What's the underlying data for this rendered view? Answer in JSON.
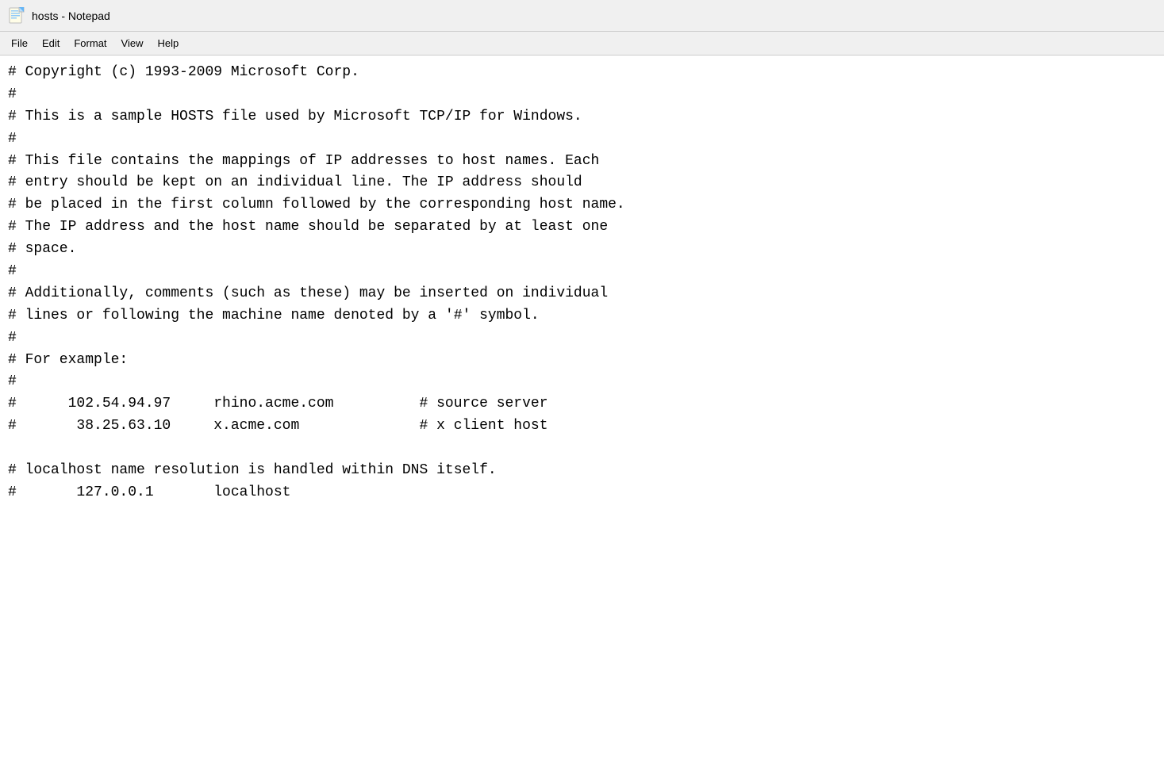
{
  "titleBar": {
    "icon": "📄",
    "title": "hosts - Notepad"
  },
  "menuBar": {
    "items": [
      "File",
      "Edit",
      "Format",
      "View",
      "Help"
    ]
  },
  "content": {
    "lines": [
      "# Copyright (c) 1993-2009 Microsoft Corp.",
      "#",
      "# This is a sample HOSTS file used by Microsoft TCP/IP for Windows.",
      "#",
      "# This file contains the mappings of IP addresses to host names. Each",
      "# entry should be kept on an individual line. The IP address should",
      "# be placed in the first column followed by the corresponding host name.",
      "# The IP address and the host name should be separated by at least one",
      "# space.",
      "#",
      "# Additionally, comments (such as these) may be inserted on individual",
      "# lines or following the machine name denoted by a '#' symbol.",
      "#",
      "# For example:",
      "#",
      "#      102.54.94.97     rhino.acme.com          # source server",
      "#       38.25.63.10     x.acme.com              # x client host",
      "",
      "# localhost name resolution is handled within DNS itself.",
      "#       127.0.0.1       localhost"
    ]
  }
}
